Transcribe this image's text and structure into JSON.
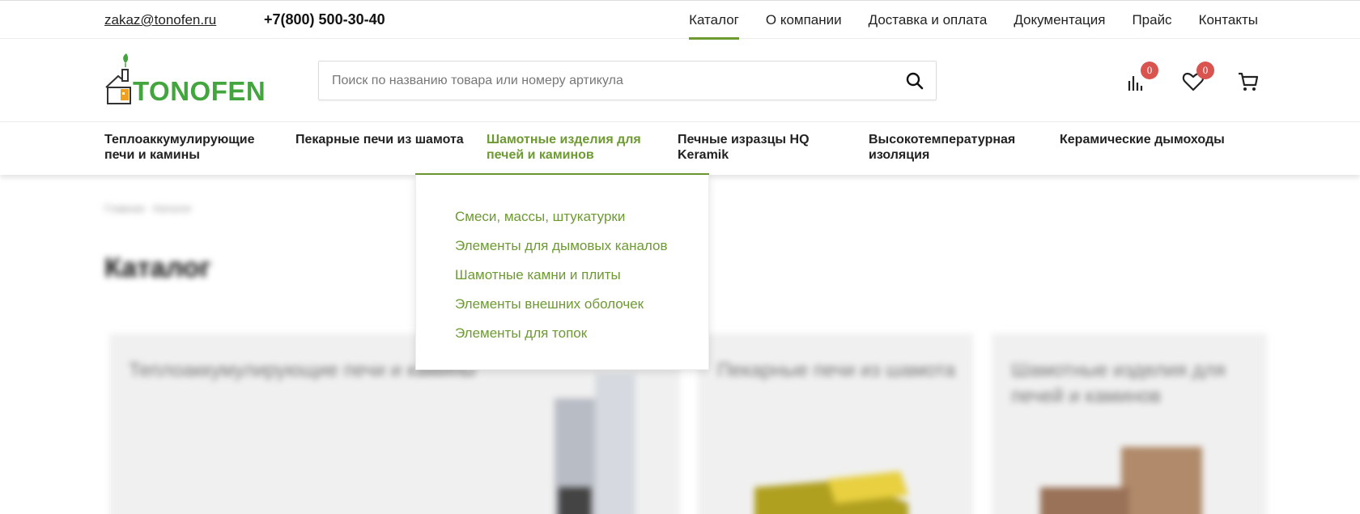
{
  "topbar": {
    "email": "zakaz@tonofen.ru",
    "phone": "+7(800) 500-30-40",
    "nav": [
      {
        "label": "Каталог",
        "active": true
      },
      {
        "label": "О компании",
        "active": false
      },
      {
        "label": "Доставка и оплата",
        "active": false
      },
      {
        "label": "Документация",
        "active": false
      },
      {
        "label": "Прайс",
        "active": false
      },
      {
        "label": "Контакты",
        "active": false
      }
    ]
  },
  "header": {
    "logo_text": "TONOFEN",
    "search_placeholder": "Поиск по названию товара или номеру артикула",
    "compare_count": "0",
    "favorites_count": "0"
  },
  "catnav": {
    "items": [
      {
        "label": "Теплоаккумулирующие печи и камины"
      },
      {
        "label": "Пекарные печи из шамота"
      },
      {
        "label": "Шамотные изделия для печей и каминов"
      },
      {
        "label": "Печные изразцы HQ Keramik"
      },
      {
        "label": "Высокотемпературная изоляция"
      },
      {
        "label": "Керамические дымоходы"
      }
    ]
  },
  "dropdown": {
    "items": [
      "Смеси, массы, штукатурки",
      "Элементы для дымовых каналов",
      "Шамотные камни и плиты",
      "Элементы внешних оболочек",
      "Элементы для топок"
    ]
  },
  "page": {
    "breadcrumb": "Главная · Каталог",
    "title": "Каталог",
    "cards": [
      "Теплоаккумулирующие печи и камины",
      "Пекарные печи из шамота",
      "Шамотные изделия для печей и каминов"
    ]
  },
  "colors": {
    "accent": "#6d9a31",
    "logo": "#43a53d",
    "badge": "#d9534f"
  }
}
